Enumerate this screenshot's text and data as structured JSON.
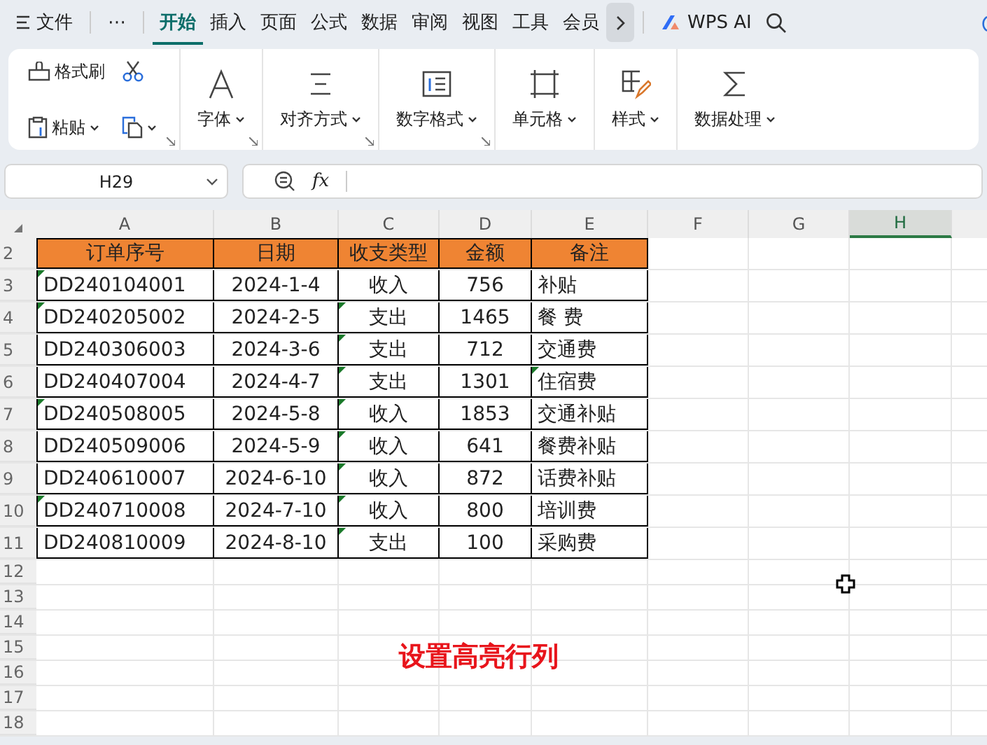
{
  "menu_bar": {
    "file": "文件",
    "more": "⋯",
    "tabs": [
      {
        "label": "开始",
        "selected": true
      },
      {
        "label": "插入",
        "selected": false
      },
      {
        "label": "页面",
        "selected": false
      },
      {
        "label": "公式",
        "selected": false
      },
      {
        "label": "数据",
        "selected": false
      },
      {
        "label": "审阅",
        "selected": false
      },
      {
        "label": "视图",
        "selected": false
      },
      {
        "label": "工具",
        "selected": false
      },
      {
        "label": "会员",
        "selected": false
      }
    ],
    "ai_label": "WPS AI"
  },
  "ribbon": {
    "format_painter": "格式刷",
    "paste": "粘贴",
    "groups": [
      {
        "label": "字体",
        "kind": "font",
        "launcher": true
      },
      {
        "label": "对齐方式",
        "kind": "align",
        "launcher": true
      },
      {
        "label": "数字格式",
        "kind": "number",
        "launcher": true
      },
      {
        "label": "单元格",
        "kind": "cell",
        "launcher": false
      },
      {
        "label": "样式",
        "kind": "style",
        "launcher": false
      },
      {
        "label": "数据处理",
        "kind": "sum",
        "launcher": false
      }
    ]
  },
  "formula_bar": {
    "name_box": "H29",
    "function_label": "fx"
  },
  "columns": [
    {
      "label": "A",
      "selected": false
    },
    {
      "label": "B",
      "selected": false
    },
    {
      "label": "C",
      "selected": false
    },
    {
      "label": "D",
      "selected": false
    },
    {
      "label": "E",
      "selected": false
    },
    {
      "label": "F",
      "selected": false
    },
    {
      "label": "G",
      "selected": false
    },
    {
      "label": "H",
      "selected": true
    }
  ],
  "rows": [
    {
      "number": "2",
      "kind": "header",
      "cells": [
        {
          "text": "订单序号",
          "flag": false
        },
        {
          "text": "日期",
          "flag": false
        },
        {
          "text": "收支类型",
          "flag": false
        },
        {
          "text": "金额",
          "flag": false
        },
        {
          "text": "备注",
          "flag": false
        }
      ]
    },
    {
      "number": "3",
      "kind": "data",
      "cells": [
        {
          "text": "DD240104001",
          "flag": true
        },
        {
          "text": "2024-1-4",
          "flag": false
        },
        {
          "text": "收入",
          "flag": false
        },
        {
          "text": "756",
          "flag": false
        },
        {
          "text": "补贴",
          "flag": false
        }
      ]
    },
    {
      "number": "4",
      "kind": "data",
      "cells": [
        {
          "text": "DD240205002",
          "flag": true
        },
        {
          "text": "2024-2-5",
          "flag": false
        },
        {
          "text": "支出",
          "flag": true
        },
        {
          "text": "1465",
          "flag": false
        },
        {
          "text": "餐 费",
          "flag": false
        }
      ]
    },
    {
      "number": "5",
      "kind": "data",
      "cells": [
        {
          "text": "DD240306003",
          "flag": false
        },
        {
          "text": "2024-3-6",
          "flag": false
        },
        {
          "text": "支出",
          "flag": true
        },
        {
          "text": "712",
          "flag": false
        },
        {
          "text": "交通费",
          "flag": false
        }
      ]
    },
    {
      "number": "6",
      "kind": "data",
      "cells": [
        {
          "text": "DD240407004",
          "flag": false
        },
        {
          "text": "2024-4-7",
          "flag": false
        },
        {
          "text": "支出",
          "flag": true
        },
        {
          "text": "1301",
          "flag": false
        },
        {
          "text": "住宿费",
          "flag": true
        }
      ]
    },
    {
      "number": "7",
      "kind": "data",
      "cells": [
        {
          "text": "DD240508005",
          "flag": true
        },
        {
          "text": "2024-5-8",
          "flag": false
        },
        {
          "text": "收入",
          "flag": true
        },
        {
          "text": "1853",
          "flag": false
        },
        {
          "text": "交通补贴",
          "flag": false
        }
      ]
    },
    {
      "number": "8",
      "kind": "data",
      "cells": [
        {
          "text": "DD240509006",
          "flag": false
        },
        {
          "text": "2024-5-9",
          "flag": false
        },
        {
          "text": "收入",
          "flag": true
        },
        {
          "text": "641",
          "flag": false
        },
        {
          "text": "餐费补贴",
          "flag": false
        }
      ]
    },
    {
      "number": "9",
      "kind": "data",
      "cells": [
        {
          "text": "DD240610007",
          "flag": false
        },
        {
          "text": "2024-6-10",
          "flag": false
        },
        {
          "text": "收入",
          "flag": true
        },
        {
          "text": "872",
          "flag": false
        },
        {
          "text": "话费补贴",
          "flag": false
        }
      ]
    },
    {
      "number": "10",
      "kind": "data",
      "cells": [
        {
          "text": "DD240710008",
          "flag": true
        },
        {
          "text": "2024-7-10",
          "flag": false
        },
        {
          "text": "收入",
          "flag": true
        },
        {
          "text": "800",
          "flag": false
        },
        {
          "text": "培训费",
          "flag": false
        }
      ]
    },
    {
      "number": "11",
      "kind": "data",
      "cells": [
        {
          "text": "DD240810009",
          "flag": false
        },
        {
          "text": "2024-8-10",
          "flag": false
        },
        {
          "text": "支出",
          "flag": true
        },
        {
          "text": "100",
          "flag": false
        },
        {
          "text": "采购费",
          "flag": false
        }
      ]
    },
    {
      "number": "12",
      "kind": "empty"
    },
    {
      "number": "13",
      "kind": "empty"
    },
    {
      "number": "14",
      "kind": "empty"
    },
    {
      "number": "15",
      "kind": "empty"
    },
    {
      "number": "16",
      "kind": "empty"
    },
    {
      "number": "17",
      "kind": "empty"
    },
    {
      "number": "18",
      "kind": "empty"
    }
  ],
  "caption": "设置高亮行列"
}
